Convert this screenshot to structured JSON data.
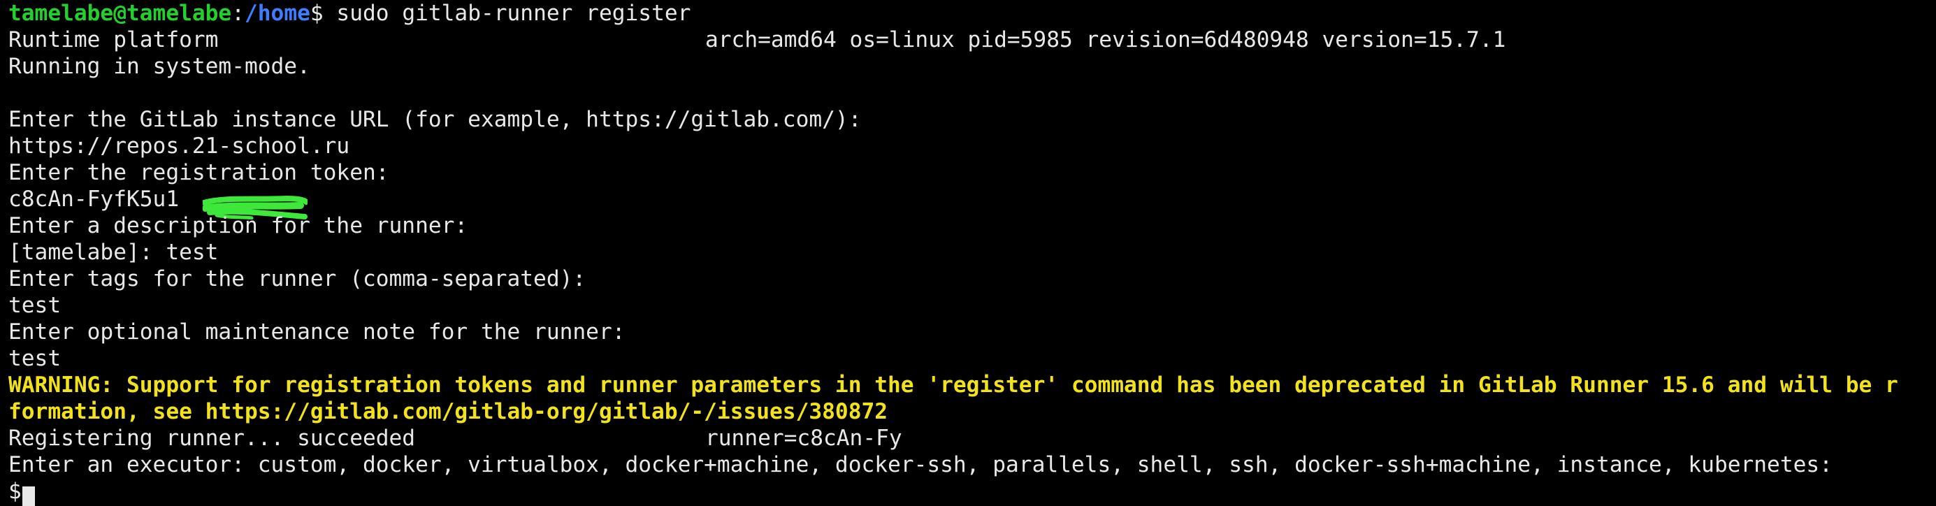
{
  "prompt": {
    "user_host": "tamelabe@tamelabe",
    "separator": ":",
    "path": "/home",
    "symbol": "$",
    "command": " sudo gitlab-runner register"
  },
  "output": {
    "runtime_label": "Runtime platform",
    "runtime_info": "arch=amd64 os=linux pid=5985 revision=6d480948 version=15.7.1",
    "mode": "Running in system-mode.",
    "url_prompt": "Enter the GitLab instance URL (for example, https://gitlab.com/):",
    "url_value": "https://repos.21-school.ru",
    "token_prompt": "Enter the registration token:",
    "token_value": "c8cAn-FyfK5u1",
    "description_prompt": "Enter a description for the runner:",
    "description_value": "[tamelabe]: test",
    "tags_prompt": "Enter tags for the runner (comma-separated):",
    "tags_value": "test",
    "note_prompt": "Enter optional maintenance note for the runner:",
    "note_value": "test",
    "warning_line1": "WARNING: Support for registration tokens and runner parameters in the 'register' command has been deprecated in GitLab Runner 15.6 and will be r",
    "warning_line2": "formation, see https://gitlab.com/gitlab-org/gitlab/-/issues/380872",
    "registering_label": "Registering runner... succeeded",
    "registering_runner": "runner=c8cAn-Fy",
    "executor_prompt": "Enter an executor: custom, docker, virtualbox, docker+machine, docker-ssh, parallels, shell, ssh, docker-ssh+machine, instance, kubernetes:",
    "final_prompt": "$"
  },
  "colors": {
    "background": "#000000",
    "text": "#e8e8e8",
    "prompt_user": "#23d12e",
    "prompt_path": "#3f7dff",
    "warning": "#f2e21c",
    "redaction": "#3ee83a"
  }
}
